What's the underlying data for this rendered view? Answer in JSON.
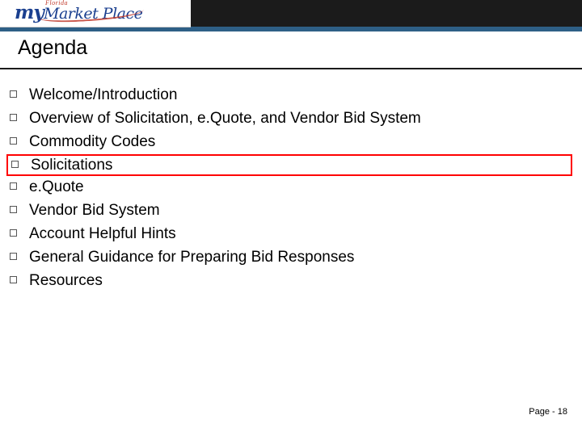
{
  "logo": {
    "my": "my",
    "florida": "Florida",
    "market_place": "Market Place"
  },
  "slide": {
    "title": "Agenda",
    "page_number": "Page - 18",
    "bullets": [
      {
        "text": "Welcome/Introduction",
        "highlighted": false
      },
      {
        "text": "Overview of Solicitation, e.Quote, and Vendor Bid System",
        "highlighted": false
      },
      {
        "text": "Commodity Codes",
        "highlighted": false
      },
      {
        "text": "Solicitations",
        "highlighted": true
      },
      {
        "text": "e.Quote",
        "highlighted": false
      },
      {
        "text": "Vendor Bid System",
        "highlighted": false
      },
      {
        "text": "Account Helpful Hints",
        "highlighted": false
      },
      {
        "text": "General Guidance for Preparing Bid Responses",
        "highlighted": false
      },
      {
        "text": "Resources",
        "highlighted": false
      }
    ]
  },
  "colors": {
    "band": "#1b1b1b",
    "accent": "#2e5f86",
    "highlight": "#ff0000",
    "logo_blue": "#1a3f8f",
    "logo_red": "#c0392b"
  }
}
